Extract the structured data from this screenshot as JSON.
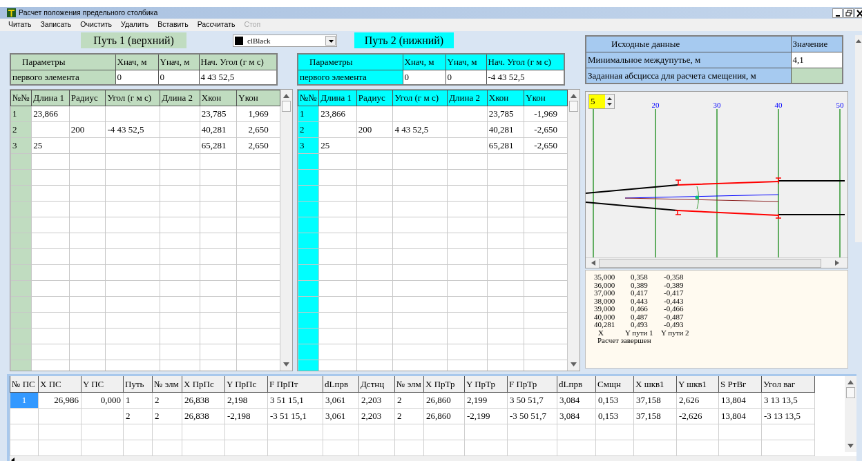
{
  "window": {
    "title": "Расчет положения предельного столбика"
  },
  "menu": [
    {
      "label": "Читать",
      "disabled": false
    },
    {
      "label": "Записать",
      "disabled": false
    },
    {
      "label": "Очистить",
      "disabled": false
    },
    {
      "label": "Удалить",
      "disabled": false
    },
    {
      "label": "Вставить",
      "disabled": false
    },
    {
      "label": "Рассчитать",
      "disabled": false
    },
    {
      "label": "Стоп",
      "disabled": true
    }
  ],
  "color_select": {
    "value": "clBlack",
    "color": "#000000"
  },
  "tracks": [
    {
      "title": "Путь 1 (верхний)",
      "color": "#c0dcc0",
      "params": {
        "columns": [
          "Параметры",
          "Xнач, м",
          "Yнач, м",
          "Нач. Угол (г м с)"
        ],
        "row": [
          "первого элемента",
          "0",
          "0",
          "4 43 52,5"
        ]
      },
      "grid": {
        "columns": [
          "№№",
          "Длина 1",
          "Радиус",
          "Угол (г м с)",
          "Длина 2",
          "Xкон",
          "Yкон"
        ],
        "rows": [
          [
            "1",
            "23,866",
            null,
            null,
            null,
            "23,785",
            "1,969"
          ],
          [
            "2",
            null,
            "200",
            "-4 43 52,5",
            null,
            "40,281",
            "2,650"
          ],
          [
            "3",
            "25",
            null,
            null,
            null,
            "65,281",
            "2,650"
          ]
        ]
      }
    },
    {
      "title": "Путь 2 (нижний)",
      "color": "#00ffff",
      "params": {
        "columns": [
          "Параметры",
          "Xнач, м",
          "Yнач, м",
          "Нач. Угол (г м с)"
        ],
        "row": [
          "первого элемента",
          "0",
          "0",
          "-4 43 52,5"
        ]
      },
      "grid": {
        "columns": [
          "№№",
          "Длина 1",
          "Радиус",
          "Угол (г м с)",
          "Длина 2",
          "Xкон",
          "Yкон"
        ],
        "rows": [
          [
            "1",
            "23,866",
            null,
            null,
            null,
            "23,785",
            "-1,969"
          ],
          [
            "2",
            null,
            "200",
            "4 43 52,5",
            null,
            "40,281",
            "-2,650"
          ],
          [
            "3",
            "25",
            null,
            null,
            null,
            "65,281",
            "-2,650"
          ]
        ]
      }
    }
  ],
  "source_data": {
    "columns": [
      "Исходные данные",
      "Значение"
    ],
    "rows": [
      {
        "label": "Минимальное междупутье, м",
        "value": "4,1"
      },
      {
        "label": "Заданная абсцисса для расчета смещения, м"
      }
    ]
  },
  "plot": {
    "scale": "5",
    "x_labels": [
      "20",
      "30",
      "40",
      "50"
    ]
  },
  "log": {
    "lines": [
      [
        "35,000",
        "0,358",
        "-0,358"
      ],
      [
        "36,000",
        "0,389",
        "-0,389"
      ],
      [
        "37,000",
        "0,417",
        "-0,417"
      ],
      [
        "38,000",
        "0,443",
        "-0,443"
      ],
      [
        "39,000",
        "0,466",
        "-0,466"
      ],
      [
        "40,000",
        "0,487",
        "-0,487"
      ],
      [
        "40,281",
        "0,493",
        "-0,493"
      ]
    ],
    "legend": [
      "X",
      "Y пути 1",
      "Y пути 2"
    ],
    "status": "Расчет завершен"
  },
  "results": {
    "columns": [
      "№ ПС",
      "X ПС",
      "Y ПС",
      "Путь",
      "№ элм",
      "X ПрПс",
      "Y ПрПс",
      "F ПрПт",
      "dLпрв",
      "Дстнц",
      "№ элм",
      "X ПрТр",
      "Y ПрТр",
      "F ПрТр",
      "dLпрв",
      "Смщн",
      "X шкв1",
      "Y шкв1",
      "S РтВг",
      "Угол ваг"
    ],
    "rows": [
      {
        "selected": true,
        "cells": [
          "1",
          "26,986",
          "0,000",
          "1",
          "2",
          "26,838",
          "2,198",
          "3 51 15,1",
          "3,061",
          "2,203",
          "2",
          "26,860",
          "2,199",
          "3 50 51,7",
          "3,084",
          "0,153",
          "37,158",
          "2,626",
          "13,804",
          "3 13 13,5"
        ]
      },
      {
        "selected": false,
        "cells": [
          null,
          null,
          null,
          "2",
          "2",
          "26,838",
          "-2,198",
          "-3 51 15,1",
          "3,061",
          "2,203",
          "2",
          "26,860",
          "-2,199",
          "-3 50 51,7",
          "3,084",
          "0,153",
          "37,158",
          "-2,626",
          "13,804",
          "-3 13 13,5"
        ]
      }
    ]
  }
}
